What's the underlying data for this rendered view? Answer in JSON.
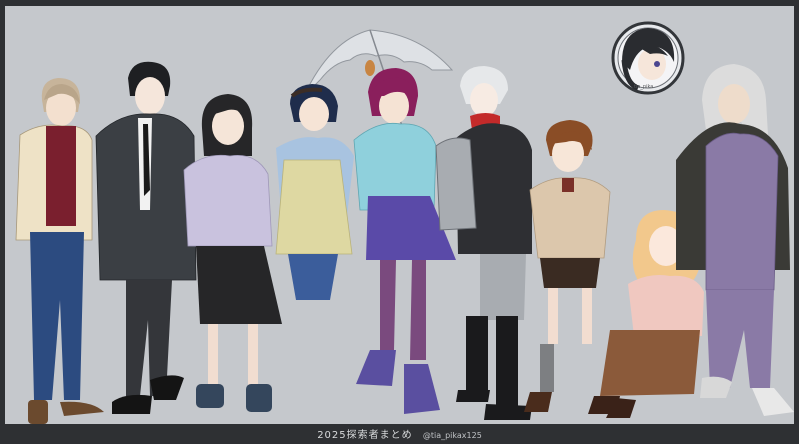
{
  "caption": {
    "title": "2025探索者まとめ",
    "handle": "@tia_pikax125"
  },
  "avatar_signature": "tia_pika",
  "palette": {
    "background": "#c5c8cc",
    "frame": "#2e3033",
    "caption_text": "#d8dadc"
  },
  "figures": [
    {
      "name": "cream-cardigan-man",
      "colors": [
        "#eee2c6",
        "#7a1f2e",
        "#2c4b80",
        "#6b4a2e"
      ]
    },
    {
      "name": "dark-coat-man",
      "colors": [
        "#3b3f44",
        "#f2f2f2",
        "#1a1a1a"
      ]
    },
    {
      "name": "lavender-sweater-girl",
      "colors": [
        "#c9c2de",
        "#262628",
        "#4a3c30"
      ]
    },
    {
      "name": "umbrella-girl",
      "colors": [
        "#a8c3e0",
        "#ded8a2",
        "#3b5d9b"
      ]
    },
    {
      "name": "teal-sweater-girl",
      "colors": [
        "#8fd0dc",
        "#5a4aa8",
        "#7a4a7e"
      ]
    },
    {
      "name": "backpack-man",
      "colors": [
        "#2e2f33",
        "#a8acb1",
        "#c32a2a"
      ]
    },
    {
      "name": "suspenders-boy",
      "colors": [
        "#dcc7ac",
        "#3a2b22",
        "#7a3028"
      ]
    },
    {
      "name": "curly-haired-girl",
      "colors": [
        "#f2c88c",
        "#f0c8c0",
        "#8b5a3a"
      ]
    },
    {
      "name": "kimono-elder",
      "colors": [
        "#8a7aa6",
        "#3a3a36",
        "#d8d8d8"
      ]
    }
  ]
}
